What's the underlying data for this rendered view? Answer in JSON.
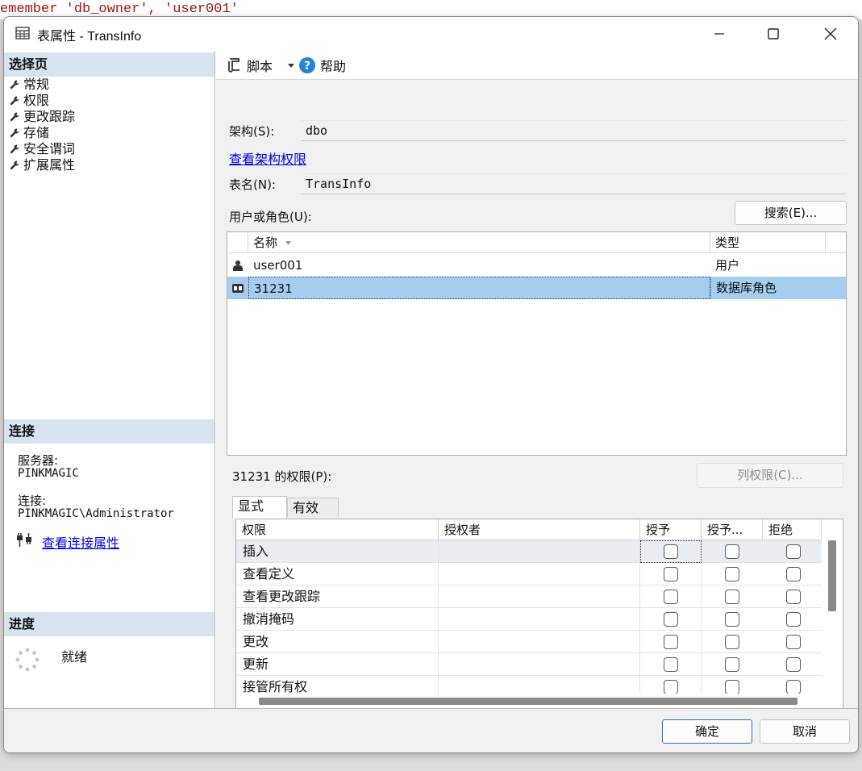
{
  "background_code": "emember 'db_owner', 'user001'",
  "window": {
    "title": "表属性 - TransInfo"
  },
  "sidebar": {
    "select_page_header": "选择页",
    "pages": [
      {
        "label": "常规"
      },
      {
        "label": "权限"
      },
      {
        "label": "更改跟踪"
      },
      {
        "label": "存储"
      },
      {
        "label": "安全谓词"
      },
      {
        "label": "扩展属性"
      }
    ],
    "connection_header": "连接",
    "server_label": "服务器:",
    "server_value": "PINKMAGIC",
    "connection_label": "连接:",
    "connection_value": "PINKMAGIC\\Administrator",
    "view_connection_link": "查看连接属性",
    "progress_header": "进度",
    "progress_status": "就绪"
  },
  "toolbar": {
    "script_label": "脚本",
    "help_label": "帮助"
  },
  "form": {
    "schema_label": "架构(S):",
    "schema_value": "dbo",
    "view_schema_permissions_link": "查看架构权限",
    "table_name_label": "表名(N):",
    "table_name_value": "TransInfo",
    "users_roles_label": "用户或角色(U):",
    "search_button": "搜索(E)..."
  },
  "principals": {
    "columns": {
      "name": "名称",
      "type": "类型"
    },
    "rows": [
      {
        "name": "user001",
        "type": "用户"
      },
      {
        "name": "31231",
        "type": "数据库角色"
      }
    ]
  },
  "permissions": {
    "label": "31231 的权限(P):",
    "column_permissions_button": "列权限(C)...",
    "tabs": [
      {
        "label": "显式"
      },
      {
        "label": "有效"
      }
    ],
    "columns": {
      "permission": "权限",
      "grantor": "授权者",
      "grant": "授予",
      "with_grant": "授予...",
      "deny": "拒绝"
    },
    "rows": [
      {
        "permission": "插入"
      },
      {
        "permission": "查看定义"
      },
      {
        "permission": "查看更改跟踪"
      },
      {
        "permission": "撤消掩码"
      },
      {
        "permission": "更改"
      },
      {
        "permission": "更新"
      },
      {
        "permission": "接管所有权"
      }
    ]
  },
  "footer": {
    "ok_button": "确定",
    "cancel_button": "取消"
  }
}
